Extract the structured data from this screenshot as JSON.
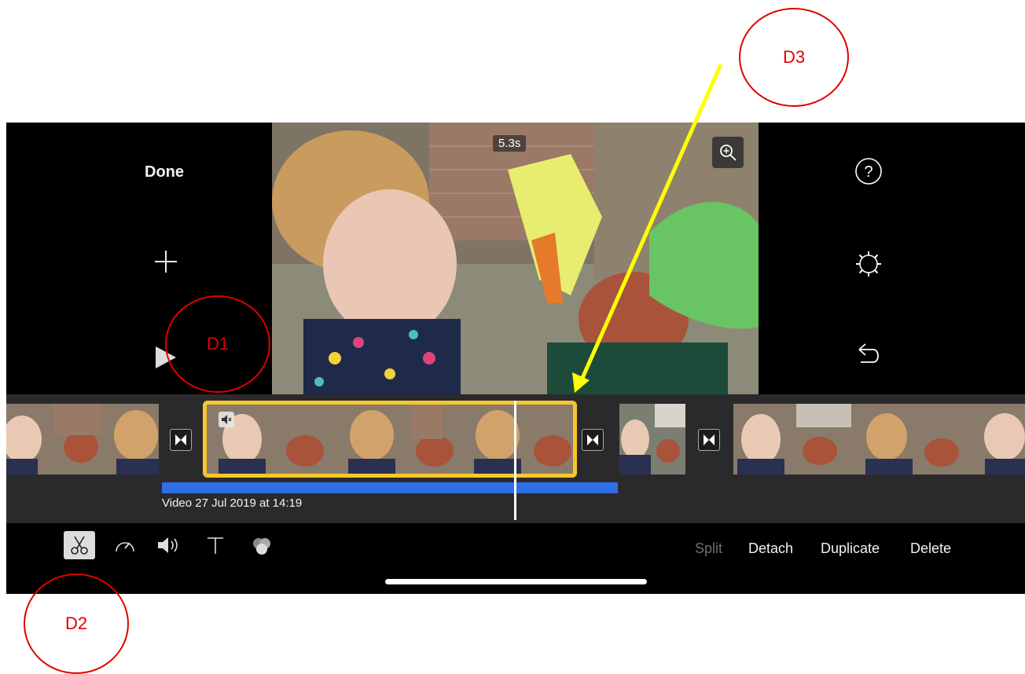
{
  "left_panel": {
    "done_label": "Done"
  },
  "preview": {
    "duration": "5.3s"
  },
  "timeline": {
    "clip_title": "Video 27 Jul 2019 at 14:19"
  },
  "toolbar": {
    "tools": [
      "scissors-icon",
      "speed-icon",
      "volume-icon",
      "text-icon",
      "filters-icon"
    ],
    "actions": {
      "split": "Split",
      "detach": "Detach",
      "duplicate": "Duplicate",
      "delete": "Delete"
    }
  },
  "annotations": {
    "d1": "D1",
    "d2": "D2",
    "d3": "D3"
  },
  "colors": {
    "accent_yellow": "#f5c72e",
    "audio_blue": "#2f6fe6",
    "annotation_red": "#e00000",
    "arrow_yellow": "#ffff00"
  }
}
